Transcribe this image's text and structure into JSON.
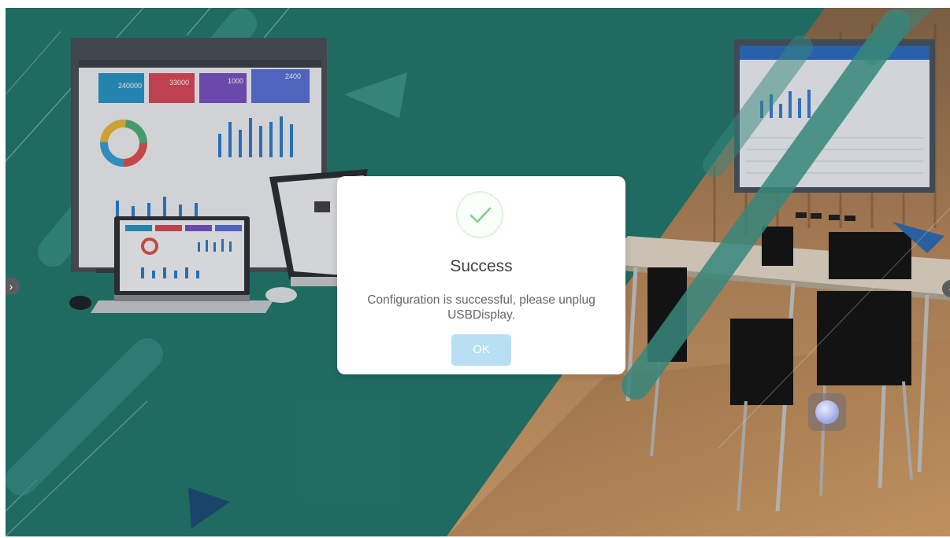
{
  "window": {
    "background_color": "#247a70"
  },
  "showcase": {
    "monitor_stats": [
      "240000",
      "33000",
      "1000",
      "2400"
    ]
  },
  "nav": {
    "left_arrow": "›",
    "right_arrow": "‹"
  },
  "dialog": {
    "icon": "check-icon",
    "title": "Success",
    "message": "Configuration is successful, please unplug USBDisplay.",
    "ok_label": "OK",
    "accent_color": "#7ed08b",
    "button_color": "#b8dff3"
  },
  "floating_button": {
    "icon": "assistive-ball-icon"
  }
}
